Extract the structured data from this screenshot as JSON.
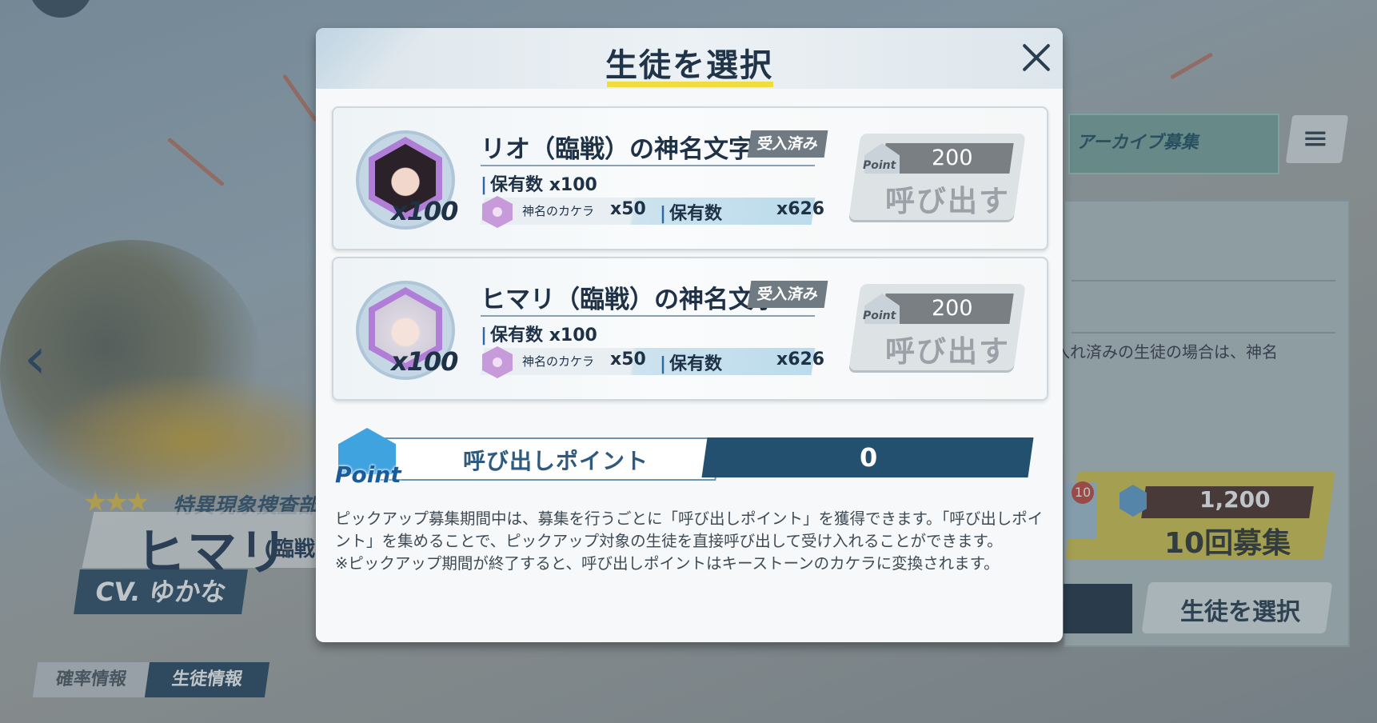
{
  "modal": {
    "title": "生徒を選択",
    "cards": [
      {
        "name": "リオ（臨戦）の神名文字",
        "badge": "受入済み",
        "qty": "x100",
        "owned": "保有数 x100",
        "currency_label": "神名のカケラ",
        "currency_cost": "x50",
        "currency_owned_label": "保有数",
        "currency_owned": "x626",
        "call_cost": "200",
        "call_icon_text": "Point",
        "call_label": "呼び出す"
      },
      {
        "name": "ヒマリ（臨戦）の神名文字",
        "badge": "受入済み",
        "qty": "x100",
        "owned": "保有数 x100",
        "currency_label": "神名のカケラ",
        "currency_cost": "x50",
        "currency_owned_label": "保有数",
        "currency_owned": "x626",
        "call_cost": "200",
        "call_icon_text": "Point",
        "call_label": "呼び出す"
      }
    ],
    "points": {
      "icon_text": "Point",
      "label": "呼び出しポイント",
      "value": "0"
    },
    "description": [
      "ピックアップ募集期間中は、募集を行うごとに「呼び出しポイント」を獲得できます。「呼び出しポイント」を集めることで、ピックアップ対象の生徒を直接呼び出して受け入れることができます。",
      "※ピックアップ期間が終了すると、呼び出しポイントはキーストーンのカケラに変換されます。"
    ]
  },
  "background": {
    "club": "特異現象捜査部",
    "char_name": "ヒマリ",
    "char_name_sub": "(臨戦",
    "cv": "CV. ゆかな",
    "tabs": [
      "確率情報",
      "生徒情報"
    ],
    "archive_label": "アーカイブ募集",
    "menu_icon": "≡",
    "right_text": "入れ済みの生徒の場合は、神名",
    "ticket_count": "10",
    "recruit_cost": "1,200",
    "recruit_label": "10回募集",
    "select_label": "生徒を選択",
    "nav_left": "‹",
    "nav_right": "›",
    "stars": "★★★"
  },
  "colors": {
    "accent_yellow": "#f1dc3d",
    "navy": "#23506f",
    "badge_gray": "#6f7a82"
  }
}
